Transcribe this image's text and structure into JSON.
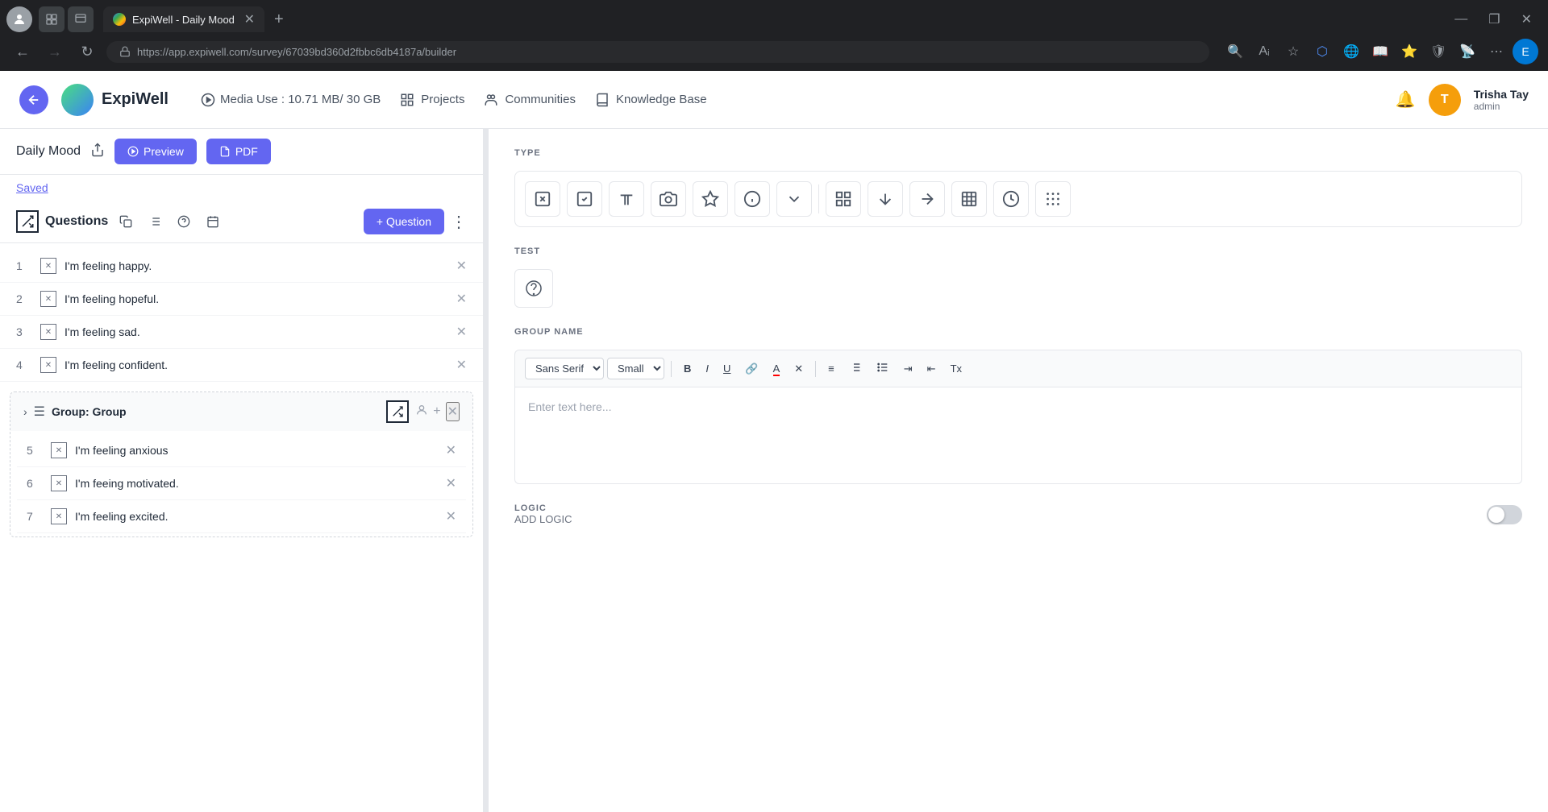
{
  "browser": {
    "tab_title": "ExpiWell - Daily Mood",
    "url": "https://app.expiwell.com/survey/67039bd360d2fbbc6db4187a/builder",
    "favicon_alt": "ExpiWell favicon"
  },
  "header": {
    "logo_text": "ExpiWell",
    "media_label": "Media Use : 10.71 MB/ 30 GB",
    "projects_label": "Projects",
    "communities_label": "Communities",
    "knowledge_base_label": "Knowledge Base",
    "user_name": "Trisha Tay",
    "user_role": "admin",
    "user_initials": "T"
  },
  "left_panel": {
    "survey_title": "Daily Mood",
    "preview_btn": "Preview",
    "pdf_btn": "PDF",
    "saved_text": "Saved",
    "questions_title": "Questions",
    "add_question_btn": "+ Question",
    "questions": [
      {
        "num": "1",
        "text": "I'm feeling happy."
      },
      {
        "num": "2",
        "text": "I'm feeling hopeful."
      },
      {
        "num": "3",
        "text": "I'm feeling sad."
      },
      {
        "num": "4",
        "text": "I'm feeling confident."
      }
    ],
    "group": {
      "title": "Group: Group",
      "questions": [
        {
          "num": "5",
          "text": "I'm feeling anxious"
        },
        {
          "num": "6",
          "text": "I'm feeing motivated."
        },
        {
          "num": "7",
          "text": "I'm feeling excited."
        }
      ]
    }
  },
  "right_panel": {
    "type_label": "TYPE",
    "test_label": "TEST",
    "group_name_label": "GROUP NAME",
    "font_family": "Sans Serif",
    "font_size": "Small",
    "text_placeholder": "Enter text here...",
    "logic_label": "LOGIC",
    "add_logic_label": "ADD LOGIC",
    "type_icons": [
      "checkbox-x",
      "checkbox-check",
      "text-t",
      "camera",
      "star",
      "info",
      "dropdown",
      "grid",
      "arrow-up-down",
      "arrow-lr",
      "grid-small",
      "clock",
      "dots-grid"
    ],
    "rich_text_buttons": [
      "B",
      "I",
      "U",
      "🔗",
      "A",
      "✕",
      "≡",
      "≡",
      "≡",
      "≡",
      "≡",
      "Tx"
    ]
  }
}
